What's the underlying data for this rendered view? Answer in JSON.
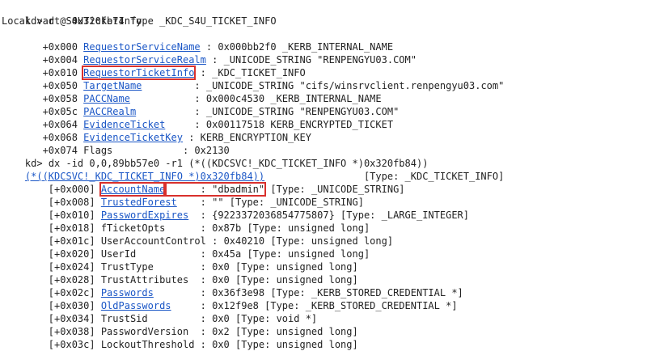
{
  "line1": {
    "prompt": "kd> ",
    "cmd": "dt S4UTicketInfo"
  },
  "line2": {
    "text": "Local var @ 0x320fb74 Type _KDC_S4U_TICKET_INFO"
  },
  "fields": [
    {
      "off": "   +0x000 ",
      "name": "RequestorServiceName",
      "pad": " : ",
      "val": "0x000bb2f0 _KERB_INTERNAL_NAME"
    },
    {
      "off": "   +0x004 ",
      "name": "RequestorServiceRealm",
      "pad": " : ",
      "val": "_UNICODE_STRING \"RENPENGYU03.COM\""
    },
    {
      "off": "   +0x010 ",
      "name": "RequestorTicketInfo",
      "pad": " : ",
      "val": "_KDC_TICKET_INFO"
    },
    {
      "off": "   +0x050 ",
      "name": "TargetName",
      "pad": "         : ",
      "val": "_UNICODE_STRING \"cifs/winsrvclient.renpengyu03.com\""
    },
    {
      "off": "   +0x058 ",
      "name": "PACCName",
      "pad": "           : ",
      "val": "0x000c4530 _KERB_INTERNAL_NAME"
    },
    {
      "off": "   +0x05c ",
      "name": "PACCRealm",
      "pad": "          : ",
      "val": "_UNICODE_STRING \"RENPENGYU03.COM\""
    },
    {
      "off": "   +0x064 ",
      "name": "EvidenceTicket",
      "pad": "     : ",
      "val": "0x00117518 KERB_ENCRYPTED_TICKET"
    },
    {
      "off": "   +0x068 ",
      "name": "EvidenceTicketKey",
      "pad": " : ",
      "val": "KERB_ENCRYPTION_KEY"
    },
    {
      "off": "   +0x074 ",
      "name": "",
      "pad": "",
      "val": "Flags            : 0x2130"
    }
  ],
  "dx": {
    "prompt": "kd> ",
    "cmd": "dx -id 0,0,89bb57e0 -r1 (*((KDCSVC!_KDC_TICKET_INFO *)0x320fb84))",
    "link": "(*((KDCSVC!_KDC_TICKET_INFO *)0x320fb84))",
    "type": "                 [Type: _KDC_TICKET_INFO]"
  },
  "members": [
    {
      "off": "    [+0x000] ",
      "name": "AccountName",
      "link": true,
      "pad": "      : ",
      "val": "\"dbadmin\"",
      "rest": " [Type: _UNICODE_STRING]"
    },
    {
      "off": "    [+0x008] ",
      "name": "TrustedForest",
      "link": true,
      "pad": "    : ",
      "val": "\"\" [Type: _UNICODE_STRING]",
      "rest": ""
    },
    {
      "off": "    [+0x010] ",
      "name": "PasswordExpires",
      "link": true,
      "pad": "  : ",
      "val": "{9223372036854775807} [Type: _LARGE_INTEGER]",
      "rest": ""
    },
    {
      "off": "    [+0x018] ",
      "name": "fTicketOpts",
      "link": false,
      "pad": "      : ",
      "val": "0x87b [Type: unsigned long]",
      "rest": ""
    },
    {
      "off": "    [+0x01c] ",
      "name": "UserAccountControl",
      "link": false,
      "pad": " : ",
      "val": "0x40210 [Type: unsigned long]",
      "rest": ""
    },
    {
      "off": "    [+0x020] ",
      "name": "UserId",
      "link": false,
      "pad": "           : ",
      "val": "0x45a [Type: unsigned long]",
      "rest": ""
    },
    {
      "off": "    [+0x024] ",
      "name": "TrustType",
      "link": false,
      "pad": "        : ",
      "val": "0x0 [Type: unsigned long]",
      "rest": ""
    },
    {
      "off": "    [+0x028] ",
      "name": "TrustAttributes",
      "link": false,
      "pad": "  : ",
      "val": "0x0 [Type: unsigned long]",
      "rest": ""
    },
    {
      "off": "    [+0x02c] ",
      "name": "Passwords",
      "link": true,
      "pad": "        : ",
      "val": "0x36f3e98 [Type: _KERB_STORED_CREDENTIAL *]",
      "rest": ""
    },
    {
      "off": "    [+0x030] ",
      "name": "OldPasswords",
      "link": true,
      "pad": "     : ",
      "val": "0x12f9e8 [Type: _KERB_STORED_CREDENTIAL *]",
      "rest": ""
    },
    {
      "off": "    [+0x034] ",
      "name": "TrustSid",
      "link": false,
      "pad": "         : ",
      "val": "0x0 [Type: void *]",
      "rest": ""
    },
    {
      "off": "    [+0x038] ",
      "name": "PasswordVersion",
      "link": false,
      "pad": "  : ",
      "val": "0x2 [Type: unsigned long]",
      "rest": ""
    },
    {
      "off": "    [+0x03c] ",
      "name": "LockoutThreshold",
      "link": false,
      "pad": " : ",
      "val": "0x0 [Type: unsigned long]",
      "rest": ""
    }
  ],
  "colors": {
    "link": "#1a56c6",
    "highlight": "#d9302c",
    "text": "#222222"
  }
}
